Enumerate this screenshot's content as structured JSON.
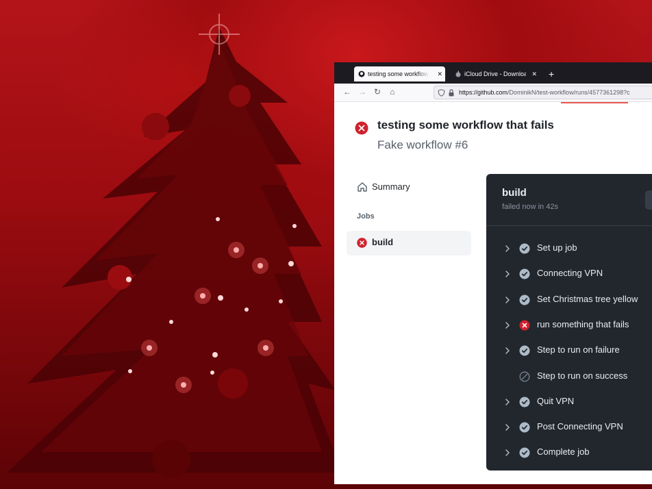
{
  "browser": {
    "tabs": [
      {
        "label": "testing some workflow that fails",
        "active": true,
        "favicon": "github-icon"
      },
      {
        "label": "iCloud Drive - Downloads",
        "active": false,
        "favicon": "apple-icon"
      }
    ],
    "new_tab_label": "+",
    "url_domain": "https://github.com",
    "url_path": "/DominikN/test-workflow/runs/4577361298?c",
    "nav": {
      "back": "←",
      "forward": "→",
      "reload": "↻",
      "home": "⌂"
    }
  },
  "run": {
    "title": "testing some workflow that fails",
    "subtitle": "Fake workflow #6",
    "status": "failure"
  },
  "sidebar": {
    "summary_label": "Summary",
    "jobs_heading": "Jobs",
    "jobs": [
      {
        "label": "build",
        "status": "failure"
      }
    ]
  },
  "job_log": {
    "title": "build",
    "status_text": "failed now in 42s",
    "steps": [
      {
        "label": "Set up job",
        "status": "success",
        "expandable": true
      },
      {
        "label": "Connecting VPN",
        "status": "success",
        "expandable": true
      },
      {
        "label": "Set Christmas tree yellow",
        "status": "success",
        "expandable": true
      },
      {
        "label": "run something that fails",
        "status": "failure",
        "expandable": true
      },
      {
        "label": "Step to run on failure",
        "status": "success",
        "expandable": true
      },
      {
        "label": "Step to run on success",
        "status": "skipped",
        "expandable": false
      },
      {
        "label": "Quit VPN",
        "status": "success",
        "expandable": true
      },
      {
        "label": "Post Connecting VPN",
        "status": "success",
        "expandable": true
      },
      {
        "label": "Complete job",
        "status": "success",
        "expandable": true
      }
    ]
  },
  "colors": {
    "failure": "#cf222e",
    "success_dark": "#adbac7",
    "log_bg": "#22272e",
    "backdrop_red": "#b3141a"
  }
}
